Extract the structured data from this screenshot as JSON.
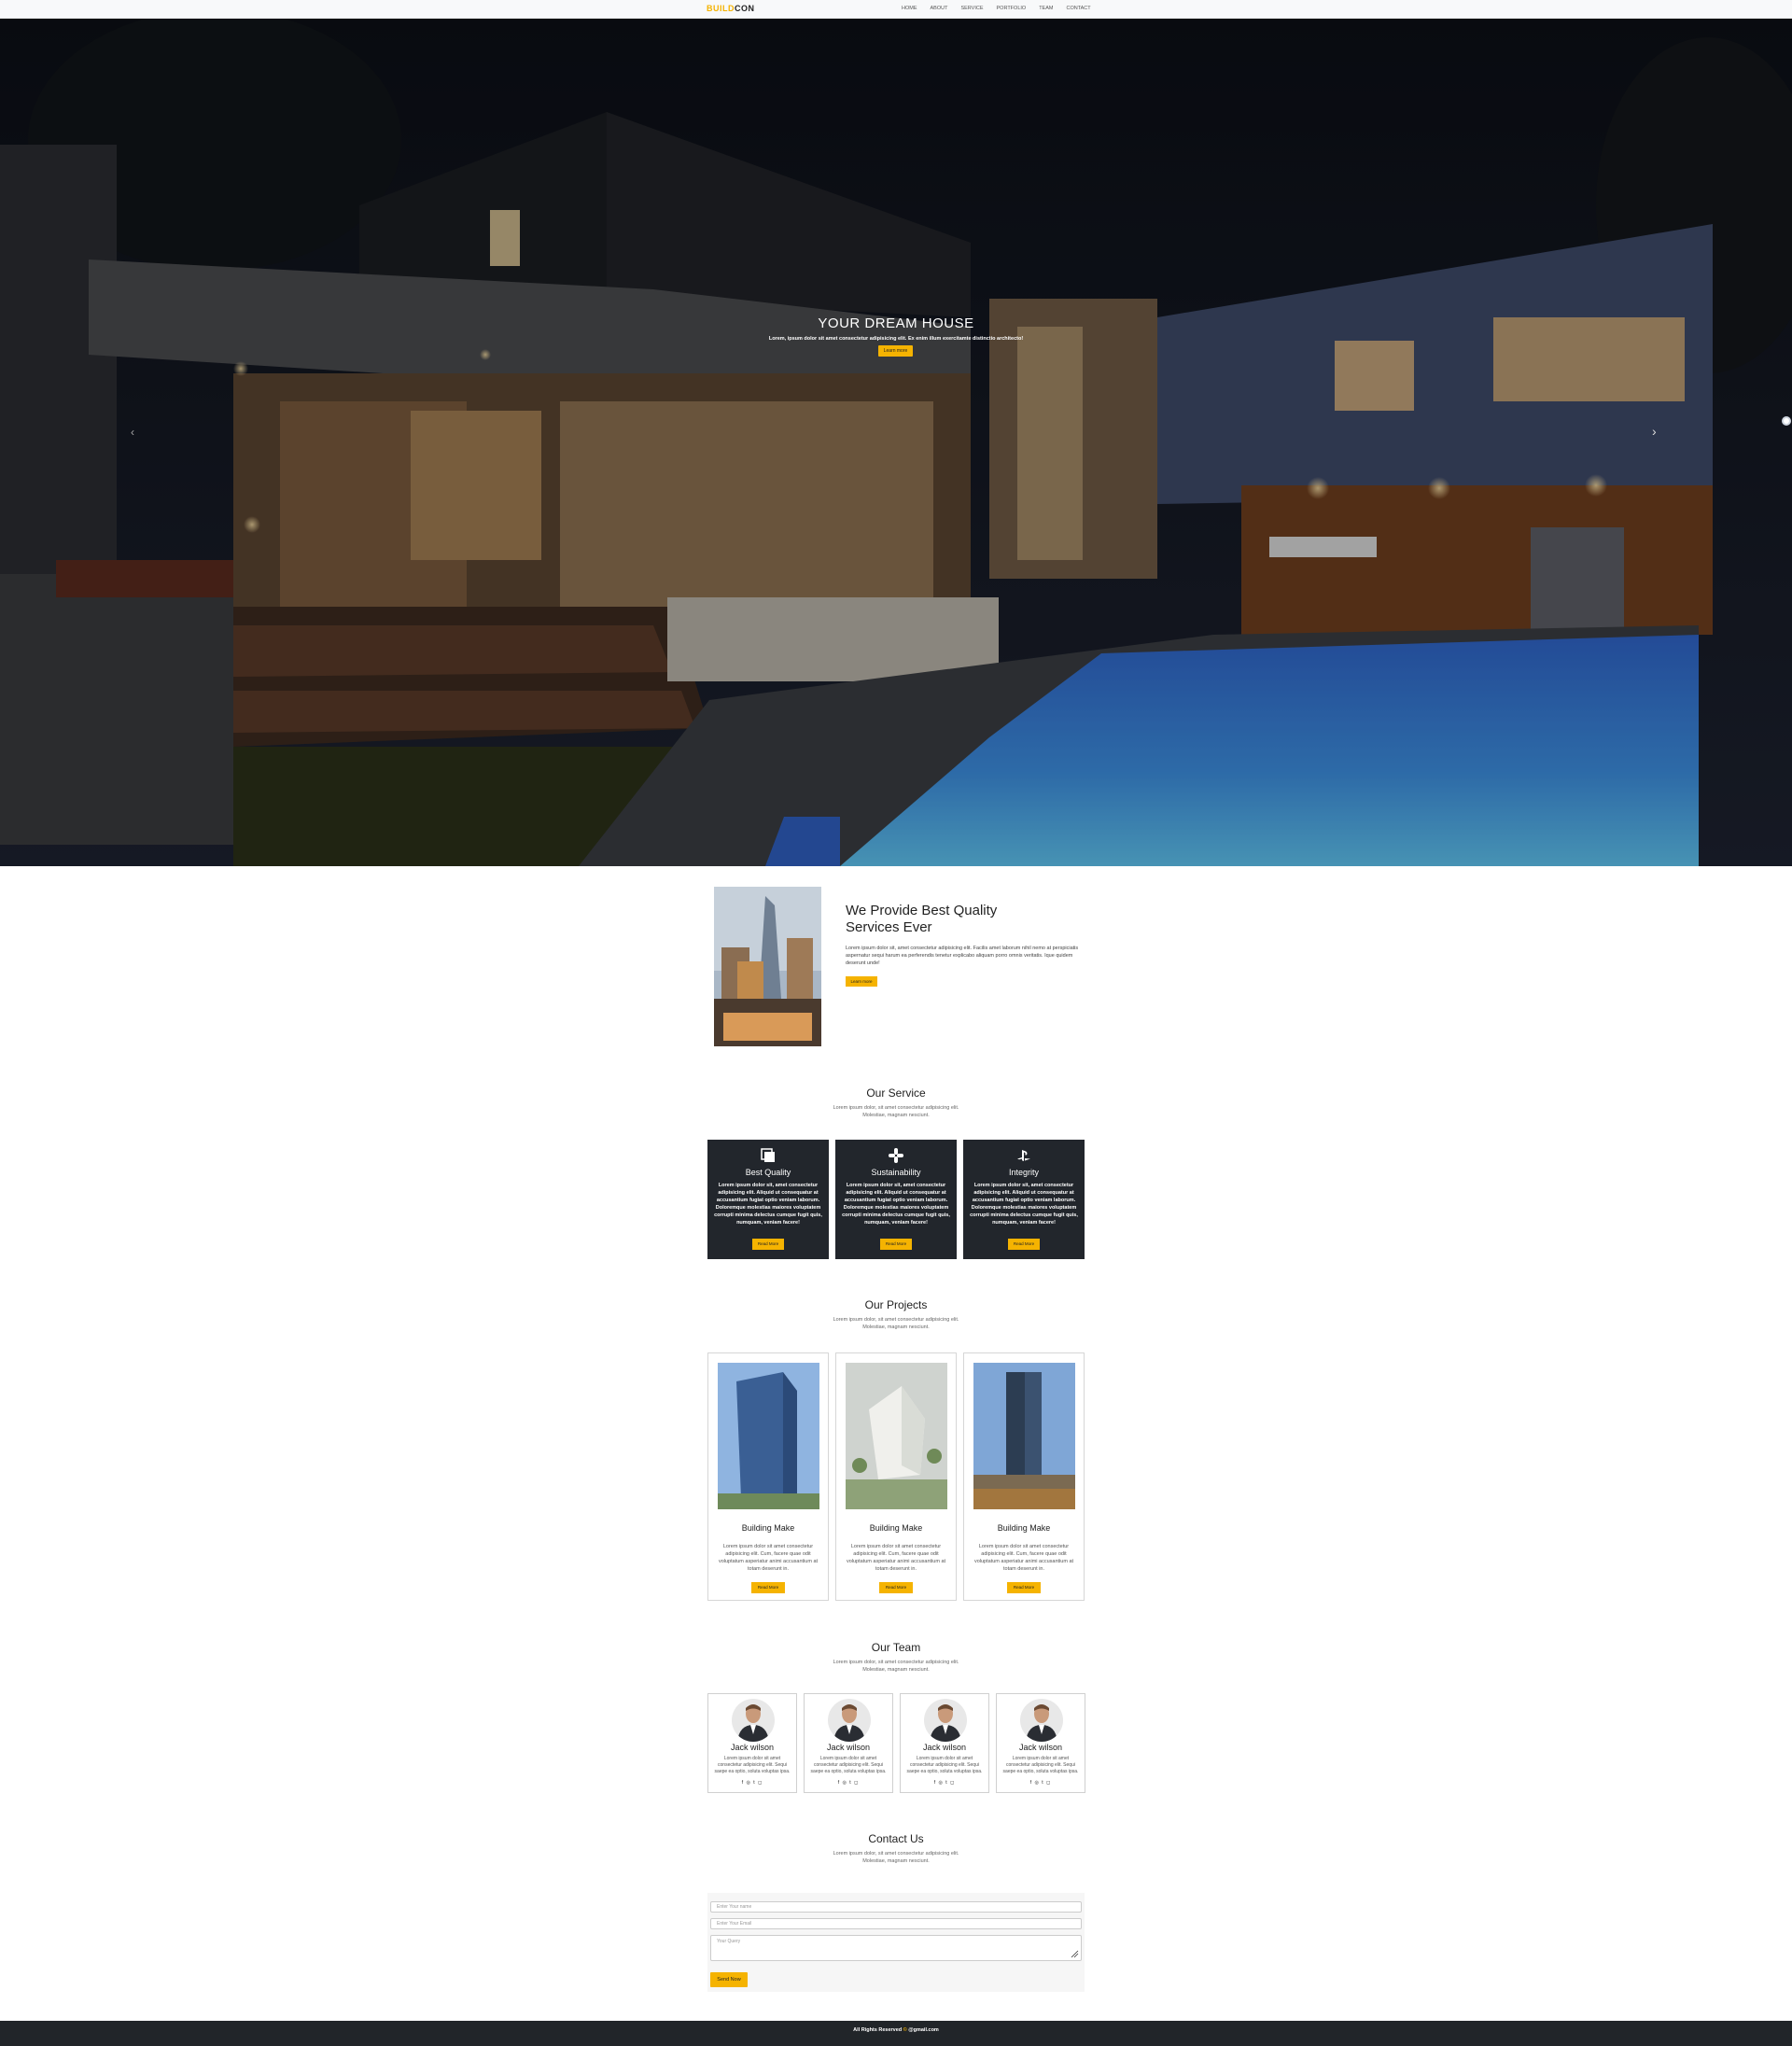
{
  "nav": {
    "brand_part1": "BUILD",
    "brand_part2": "CON",
    "links": [
      "HOME",
      "ABOUT",
      "SERVICE",
      "PORTFOLIO",
      "TEAM",
      "CONTACT"
    ]
  },
  "hero": {
    "title": "YOUR DREAM HOUSE",
    "subtitle": "Lorem, ipsum dolor sit amet consectetur adipisicing elit. Ex enim illum exercitamte distinctio architecto!",
    "button_label": "Learn more",
    "prev_icon": "‹",
    "next_icon": "›"
  },
  "about": {
    "title_line1": "We Provide Best Quality",
    "title_line2": "Services Ever",
    "text": "Lorem ipsum dolor sit, amet consectetur adipisicing elit. Facilis amet laborum nihil nemo at perspiciatis aspernatur sequi harum ea perferendis tenetur explicabo aliquam porro omnis veritatis. Ique quidem deserunt unde!",
    "button_label": "Learn more"
  },
  "service": {
    "title": "Our Service",
    "subtitle": "Lorem ipsum dolor, sit amet consectetur adipisicing elit. Molestiae, magnam nesciunt.",
    "cards": [
      {
        "icon": "layers-icon",
        "name": "Best Quality",
        "text": "Lorem ipsum dolor sit, amet consectetur adipisicing elit. Aliquid ut consequatur at accusantium fugiat optio veniam laborum. Doloremque molestias maiores voluptatem corrupti minima delectus cumque fugit quis, numquam, veniam facere!",
        "button": "Read More"
      },
      {
        "icon": "slack-icon",
        "name": "Sustainability",
        "text": "Lorem ipsum dolor sit, amet consectetur adipisicing elit. Aliquid ut consequatur at accusantium fugiat optio veniam laborum. Doloremque molestias maiores voluptatem corrupti minima delectus cumque fugit quis, numquam, veniam facere!",
        "button": "Read More"
      },
      {
        "icon": "playstation-icon",
        "name": "Integrity",
        "text": "Lorem ipsum dolor sit, amet consectetur adipisicing elit. Aliquid ut consequatur at accusantium fugiat optio veniam laborum. Doloremque molestias maiores voluptatem corrupti minima delectus cumque fugit quis, numquam, veniam facere!",
        "button": "Read More"
      }
    ]
  },
  "projects": {
    "title": "Our Projects",
    "subtitle": "Lorem ipsum dolor, sit amet consectetur adipisicing elit. Molestiae, magnam nesciunt.",
    "cards": [
      {
        "name": "Building Make",
        "text": "Lorem ipsum dolor sit amet consectetur adipisicing elit. Cum, facere quae odit voluptatum asperiatur animi accusantium at totam deserunt in.",
        "button": "Read More"
      },
      {
        "name": "Building Make",
        "text": "Lorem ipsum dolor sit amet consectetur adipisicing elit. Cum, facere quae odit voluptatum asperiatur animi accusantium at totam deserunt in.",
        "button": "Read More"
      },
      {
        "name": "Building Make",
        "text": "Lorem ipsum dolor sit amet consectetur adipisicing elit. Cum, facere quae odit voluptatum asperiatur animi accusantium at totam deserunt in.",
        "button": "Read More"
      }
    ]
  },
  "team": {
    "title": "Our Team",
    "subtitle": "Lorem ipsum dolor, sit amet consectetur adipisicing elit. Molestiae, magnam nesciunt.",
    "members": [
      {
        "name": "Jack wilson",
        "text": "Lorem ipsum dolor sit amet consectetur adipisicing elit. Sequi saepe ea optio, soluta voluptas ipsa.",
        "socials": "f  ◎  t  ◻"
      },
      {
        "name": "Jack wilson",
        "text": "Lorem ipsum dolor sit amet consectetur adipisicing elit. Sequi saepe ea optio, soluta voluptas ipsa.",
        "socials": "f  ◎  t  ◻"
      },
      {
        "name": "Jack wilson",
        "text": "Lorem ipsum dolor sit amet consectetur adipisicing elit. Sequi saepe ea optio, soluta voluptas ipsa.",
        "socials": "f  ◎  t  ◻"
      },
      {
        "name": "Jack wilson",
        "text": "Lorem ipsum dolor sit amet consectetur adipisicing elit. Sequi saepe ea optio, soluta voluptas ipsa.",
        "socials": "f  ◎  t  ◻"
      }
    ]
  },
  "contact": {
    "title": "Contact Us",
    "subtitle": "Lorem ipsum dolor, sit amet consectetur adipisicing elit. Molestiae, magnam nesciunt.",
    "name_placeholder": "Enter Your name",
    "email_placeholder": "Enter Your Email",
    "query_placeholder": "Your Query",
    "button_label": "Send Now"
  },
  "footer": {
    "text_before": "All Rights Reserved",
    "accent": "© ",
    "text_after": "@gmail.com"
  },
  "colors": {
    "accent": "#f5b301",
    "dark_card": "#22262c",
    "footer_bg": "#212529"
  }
}
